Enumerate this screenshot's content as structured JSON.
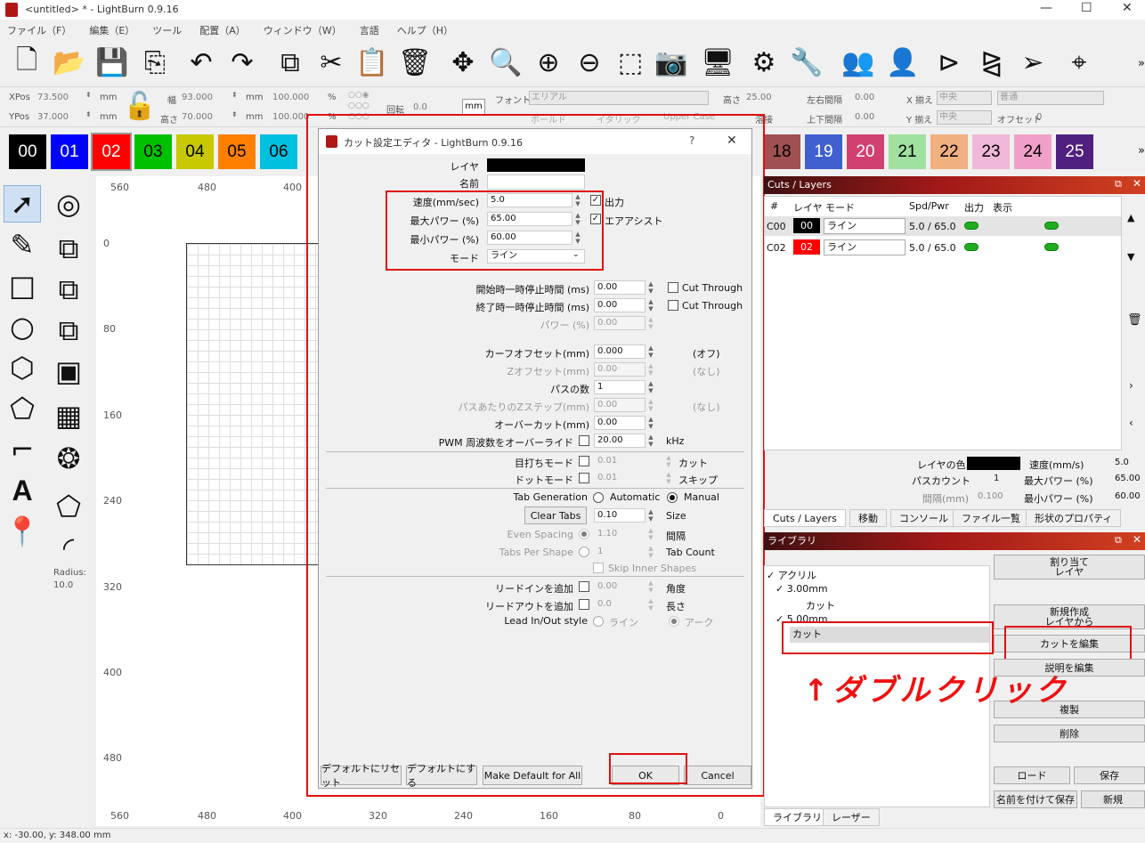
{
  "window": {
    "title": "<untitled> * - LightBurn 0.9.16"
  },
  "menu": [
    "ファイル（F）",
    "編集（E）",
    "ツール",
    "配置（A）",
    "ウィンドウ（W）",
    "言語",
    "ヘルプ（H）"
  ],
  "props": {
    "xpos_label": "XPos",
    "xpos": "73.500",
    "ypos_label": "YPos",
    "ypos": "37.000",
    "unit": "mm",
    "width_label": "幅",
    "width": "93.000",
    "height_label": "高さ",
    "height": "70.000",
    "pct1": "100.000",
    "pct2": "100.000",
    "pct_unit": "%",
    "rotate_label": "回転",
    "rotate": "0.0",
    "mm_button": "mm",
    "font_label": "フォント",
    "font": "エリアル",
    "fheight_label": "高さ",
    "fheight": "25.00",
    "hspace_label": "左右間隔",
    "hspace": "0.00",
    "vspace_label": "上下間隔",
    "vspace": "0.00",
    "xalign_label": "X 揃え",
    "xalign": "中央",
    "yalign_label": "Y 揃え",
    "yalign": "中央",
    "normal": "普通",
    "offset_label": "オフセット",
    "offset": "0",
    "bold": "ボールド",
    "italic": "イタリック",
    "upper": "Upper Case",
    "weld": "溶接"
  },
  "palette": [
    {
      "n": "00",
      "bg": "#000000",
      "fg": "#ffffff"
    },
    {
      "n": "01",
      "bg": "#0000ff",
      "fg": "#ffffff"
    },
    {
      "n": "02",
      "bg": "#ff0000",
      "fg": "#ffffff"
    },
    {
      "n": "03",
      "bg": "#00c000",
      "fg": "#000000"
    },
    {
      "n": "04",
      "bg": "#c8c800",
      "fg": "#000000"
    },
    {
      "n": "05",
      "bg": "#ff8000",
      "fg": "#000000"
    },
    {
      "n": "06",
      "bg": "#00c0e0",
      "fg": "#000000"
    },
    {
      "n": "18",
      "bg": "#a05050",
      "fg": "#000000"
    },
    {
      "n": "19",
      "bg": "#4060d0",
      "fg": "#ffffff"
    },
    {
      "n": "20",
      "bg": "#d04070",
      "fg": "#ffffff"
    },
    {
      "n": "21",
      "bg": "#a0e0a0",
      "fg": "#000000"
    },
    {
      "n": "22",
      "bg": "#f0b080",
      "fg": "#000000"
    },
    {
      "n": "23",
      "bg": "#f0b8d8",
      "fg": "#000000"
    },
    {
      "n": "24",
      "bg": "#f0a0c8",
      "fg": "#000000"
    },
    {
      "n": "25",
      "bg": "#502080",
      "fg": "#ffffff"
    }
  ],
  "more": "»",
  "ruler": {
    "top": [
      "560",
      "480",
      "400",
      "320",
      "240",
      "160",
      "80",
      "0"
    ],
    "left": [
      "0",
      "80",
      "160",
      "240",
      "320",
      "400",
      "480"
    ]
  },
  "radius": {
    "label": "Radius:",
    "value": "10.0"
  },
  "dialog": {
    "title": "カット設定エディタ - LightBurn 0.9.16",
    "help": "?",
    "close": "✕",
    "layer_label": "レイヤ",
    "name_label": "名前",
    "speed_label": "速度(mm/sec)",
    "speed": "5.0",
    "maxpow_label": "最大パワー (%)",
    "maxpow": "65.00",
    "minpow_label": "最小パワー (%)",
    "minpow": "60.00",
    "mode_label": "モード",
    "mode": "ライン",
    "output_label": "出力",
    "airassist_label": "エアアシスト",
    "startdelay_label": "開始時一時停止時間 (ms)",
    "startdelay": "0.00",
    "enddelay_label": "終了時一時停止時間 (ms)",
    "enddelay": "0.00",
    "cutthrough": "Cut Through",
    "power_label": "パワー (%)",
    "power": "0.00",
    "kerf_label": "カーフオフセット(mm)",
    "kerf": "0.000",
    "kerf_note": "(オフ)",
    "zoffset_label": "Zオフセット(mm)",
    "zoffset": "0.00",
    "zoffset_note": "(なし)",
    "passes_label": "パスの数",
    "passes": "1",
    "zstep_label": "パスあたりのZステップ(mm)",
    "zstep": "0.00",
    "zstep_note": "(なし)",
    "overcut_label": "オーバーカット(mm)",
    "overcut": "0.00",
    "pwm_label": "PWM 周波数をオーバーライド",
    "pwm": "20.00",
    "pwm_unit": "kHz",
    "perf_label": "目打ちモード",
    "perf": "0.01",
    "perf_note": "カット",
    "dot_label": "ドットモード",
    "dot": "0.01",
    "dot_note": "スキップ",
    "tabgen_label": "Tab Generation",
    "automatic": "Automatic",
    "manual": "Manual",
    "cleartabs": "Clear Tabs",
    "tabsize": "0.10",
    "size_label": "Size",
    "evenspacing_label": "Even Spacing",
    "evenspacing": "1.10",
    "spacing_note": "間隔",
    "tabspershape_label": "Tabs Per Shape",
    "tabspershape": "1",
    "tabcount_note": "Tab Count",
    "skipinner": "Skip Inner Shapes",
    "leadin_label": "リードインを追加",
    "leadin": "0.00",
    "angle_note": "角度",
    "leadout_label": "リードアウトを追加",
    "leadout": "0.0",
    "length_note": "長さ",
    "leadstyle_label": "Lead In/Out style",
    "line_opt": "ライン",
    "arc_opt": "アーク",
    "reset_default": "デフォルトにリセット",
    "make_default": "デフォルトにする",
    "make_default_all": "Make Default for All",
    "ok": "OK",
    "cancel": "Cancel"
  },
  "cuts": {
    "title": "Cuts / Layers",
    "cols": [
      "#",
      "レイヤ",
      "モード",
      "Spd/Pwr",
      "出力",
      "表示"
    ],
    "rows": [
      {
        "id": "C00",
        "layer": "00",
        "color": "#000000",
        "mode": "ライン",
        "sp": "5.0 / 65.0"
      },
      {
        "id": "C02",
        "layer": "02",
        "color": "#ff0000",
        "mode": "ライン",
        "sp": "5.0 / 65.0"
      }
    ],
    "layer_color_label": "レイヤの色",
    "speed_label": "速度(mm/s)",
    "speed": "5.0",
    "passcount_label": "パスカウント",
    "passcount": "1",
    "maxpow_label": "最大パワー (%)",
    "maxpow": "65.00",
    "interval_label": "間隔(mm)",
    "interval": "0.100",
    "minpow_label": "最小パワー (%)",
    "minpow": "60.00"
  },
  "tabs": [
    "Cuts / Layers",
    "移動",
    "コンソール",
    "ファイル一覧",
    "形状のプロパティ"
  ],
  "library": {
    "title": "ライブラリ",
    "tree": [
      {
        "t": "アクリル",
        "lvl": 0,
        "arrow": "✓"
      },
      {
        "t": "3.00mm",
        "lvl": 1,
        "arrow": "✓"
      },
      {
        "t": "カット",
        "lvl": 2,
        "arrow": ""
      },
      {
        "t": "5.00mm",
        "lvl": 1,
        "arrow": "✓"
      },
      {
        "t": "カット",
        "lvl": 2,
        "arrow": ""
      }
    ],
    "assign": "割り当て\nレイヤ",
    "new_from": "新規作成\nレイヤから",
    "edit_cut": "カットを編集",
    "edit_desc": "説明を編集",
    "duplicate": "複製",
    "delete": "削除",
    "load": "ロード",
    "save": "保存",
    "save_as": "名前を付けて保存",
    "new": "新規"
  },
  "annotation": "↑ダブルクリック",
  "bottom_tabs": [
    "ライブラリ",
    "レーザー"
  ],
  "status": "x: -30.00, y: 348.00 mm"
}
